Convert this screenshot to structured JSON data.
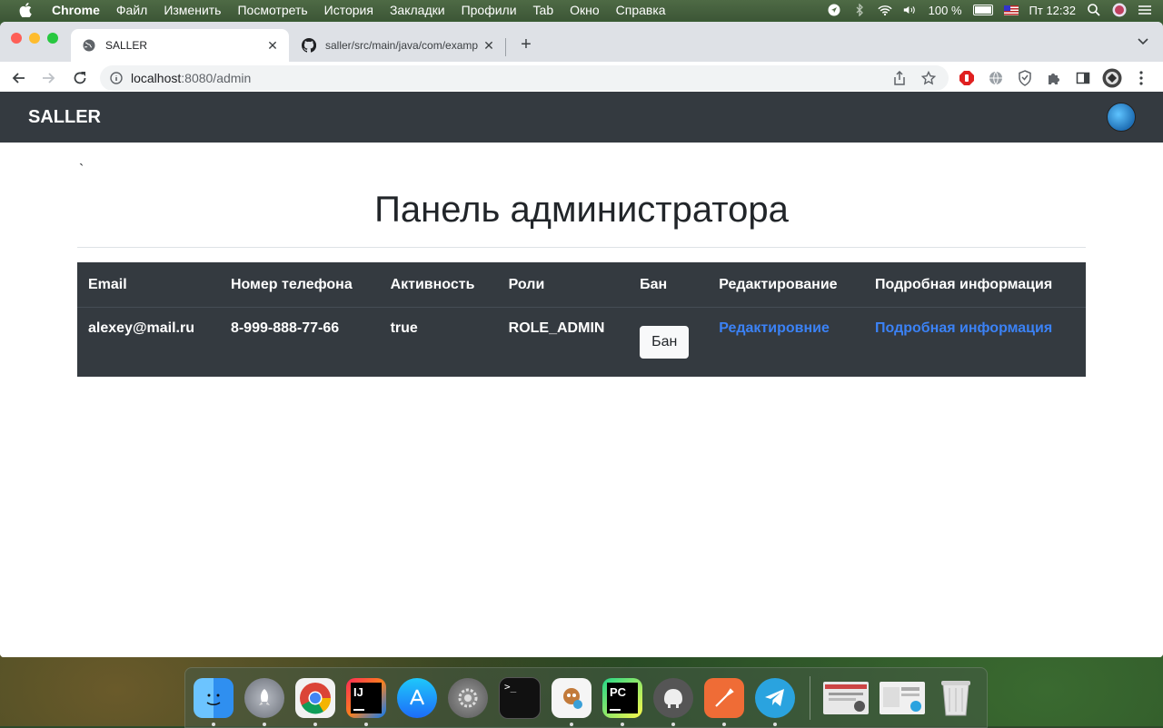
{
  "menubar": {
    "app_name": "Chrome",
    "items": [
      "Файл",
      "Изменить",
      "Посмотреть",
      "История",
      "Закладки",
      "Профили",
      "Tab",
      "Окно",
      "Справка"
    ],
    "battery": "100 %",
    "clock": "Пт 12:32"
  },
  "browser": {
    "tabs": [
      {
        "title": "SALLER"
      },
      {
        "title": "saller/src/main/java/com/examp"
      }
    ],
    "url_host": "localhost",
    "url_rest": ":8080/admin"
  },
  "page": {
    "brand": "SALLER",
    "backtick": "`",
    "heading": "Панель администратора",
    "table": {
      "headers": [
        "Email",
        "Номер телефона",
        "Активность",
        "Роли",
        "Бан",
        "Редактирование",
        "Подробная информация"
      ],
      "rows": [
        {
          "email": "alexey@mail.ru",
          "phone": "8-999-888-77-66",
          "active": "true",
          "role": "ROLE_ADMIN",
          "ban_label": "Бан",
          "edit_label": "Редактировние",
          "details_label": "Подробная информация"
        }
      ]
    }
  },
  "dock": {
    "apps": [
      {
        "name": "finder-icon",
        "color": "#2f8ff0",
        "label": ""
      },
      {
        "name": "launchpad-icon",
        "color": "#8a8f98",
        "label": ""
      },
      {
        "name": "chrome-icon",
        "color": "#e8e8e8",
        "label": ""
      },
      {
        "name": "intellij-icon",
        "color": "#1b1b3a",
        "label": "IJ"
      },
      {
        "name": "app-store-icon",
        "color": "#1d8cf8",
        "label": ""
      },
      {
        "name": "system-preferences-icon",
        "color": "#7a7a7a",
        "label": ""
      },
      {
        "name": "terminal-icon",
        "color": "#111111",
        "label": ">_"
      },
      {
        "name": "paw-icon",
        "color": "#f2f2f2",
        "label": ""
      },
      {
        "name": "pycharm-icon",
        "color": "#1a1a1a",
        "label": "PC"
      },
      {
        "name": "tableplus-icon",
        "color": "#4a4a4a",
        "label": ""
      },
      {
        "name": "postman-icon",
        "color": "#ef6c36",
        "label": ""
      },
      {
        "name": "telegram-icon",
        "color": "#2aa3df",
        "label": ""
      }
    ],
    "recent": [
      {
        "name": "recent-window-1-icon",
        "color": "#e6e6e6"
      },
      {
        "name": "recent-window-2-icon",
        "color": "#e6e6e6"
      },
      {
        "name": "trash-icon",
        "color": "#cfcfcf"
      }
    ]
  }
}
